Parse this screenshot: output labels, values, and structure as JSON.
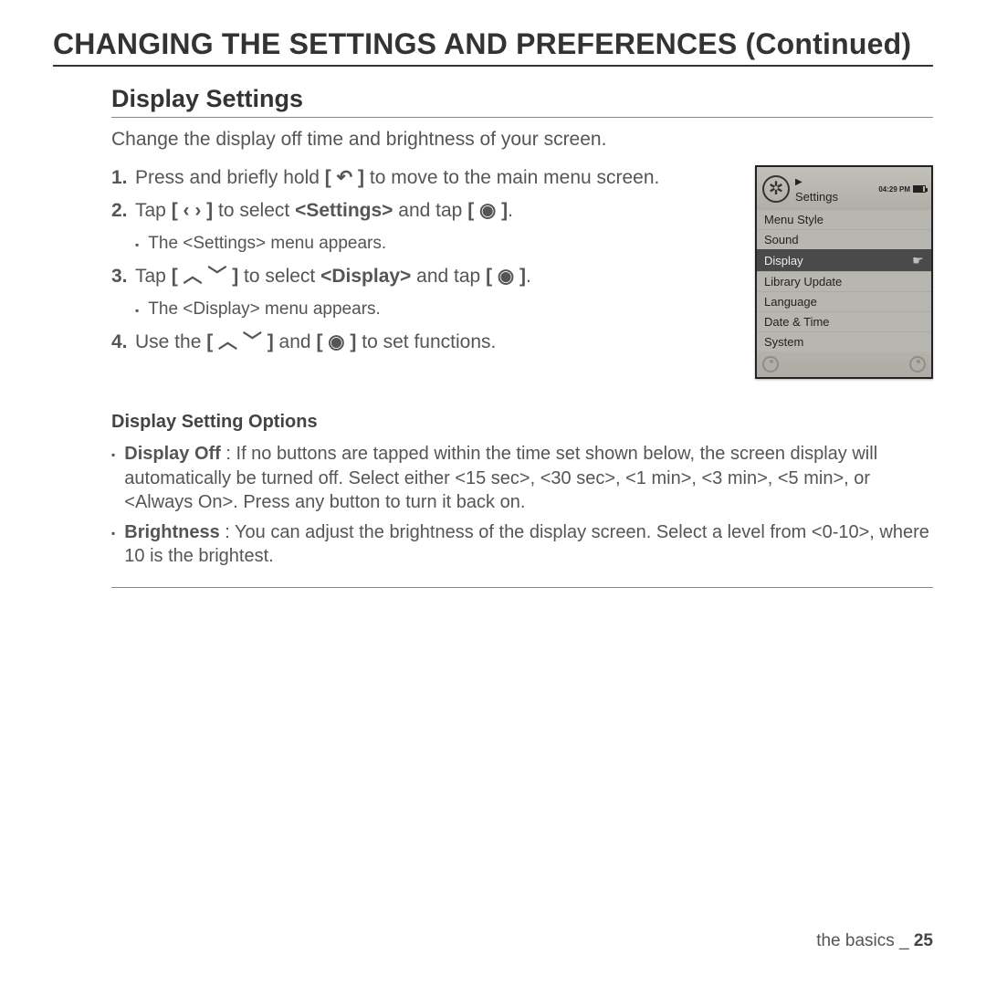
{
  "page_title": "CHANGING THE SETTINGS AND PREFERENCES (Continued)",
  "section_title": "Display Settings",
  "intro": "Change the display off time and brightness of your screen.",
  "steps": {
    "s1_num": "1.",
    "s1_a": "Press and briefly hold ",
    "s1_icon": "[ ↶ ]",
    "s1_b": " to move to the main menu screen.",
    "s2_num": "2.",
    "s2_a": "Tap ",
    "s2_icon1": "[ ‹  › ]",
    "s2_b": " to select ",
    "s2_bold": "<Settings>",
    "s2_c": " and tap ",
    "s2_icon2": "[ ◉ ]",
    "s2_d": ".",
    "s2_sub": "The <Settings> menu appears.",
    "s3_num": "3.",
    "s3_a": "Tap ",
    "s3_icon1": "[ ︿ ﹀ ]",
    "s3_b": " to select ",
    "s3_bold": "<Display>",
    "s3_c": " and tap ",
    "s3_icon2": "[ ◉ ]",
    "s3_d": ".",
    "s3_sub": "The <Display> menu appears.",
    "s4_num": "4.",
    "s4_a": "Use the ",
    "s4_icon1": "[ ︿ ﹀ ]",
    "s4_b": " and ",
    "s4_icon2": "[ ◉ ]",
    "s4_c": " to set functions."
  },
  "device": {
    "time": "04:29 PM",
    "title": "Settings",
    "items": [
      "Menu Style",
      "Sound",
      "Display",
      "Library Update",
      "Language",
      "Date & Time",
      "System"
    ],
    "selected_index": 2
  },
  "options_title": "Display Setting Options",
  "options": {
    "o1_bold": "Display Off",
    "o1_rest": " : If no buttons are tapped within the time set shown below, the screen display will automatically be turned off. Select either <15 sec>, <30 sec>, <1 min>, <3 min>, <5 min>, or <Always On>. Press any button to turn it back on.",
    "o2_bold": "Brightness",
    "o2_rest": " : You can adjust the brightness of the display screen. Select a level from <0-10>, where 10 is the brightest."
  },
  "footer_section": "the basics _ ",
  "footer_page": "25"
}
